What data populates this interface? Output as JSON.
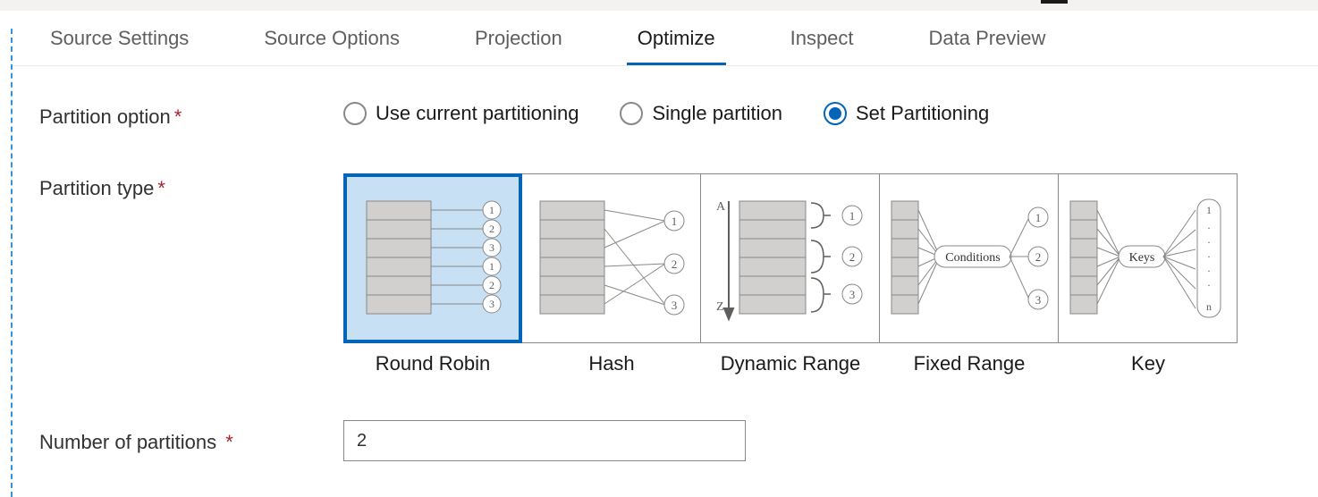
{
  "tabs": [
    {
      "label": "Source Settings",
      "active": false
    },
    {
      "label": "Source Options",
      "active": false
    },
    {
      "label": "Projection",
      "active": false
    },
    {
      "label": "Optimize",
      "active": true
    },
    {
      "label": "Inspect",
      "active": false
    },
    {
      "label": "Data Preview",
      "active": false
    }
  ],
  "form": {
    "partition_option": {
      "label": "Partition option",
      "options": [
        {
          "label": "Use current partitioning",
          "checked": false
        },
        {
          "label": "Single partition",
          "checked": false
        },
        {
          "label": "Set Partitioning",
          "checked": true
        }
      ]
    },
    "partition_type": {
      "label": "Partition type",
      "tiles": [
        {
          "label": "Round Robin",
          "selected": true
        },
        {
          "label": "Hash",
          "selected": false
        },
        {
          "label": "Dynamic Range",
          "selected": false
        },
        {
          "label": "Fixed Range",
          "selected": false
        },
        {
          "label": "Key",
          "selected": false
        }
      ]
    },
    "num_partitions": {
      "label": "Number of partitions",
      "value": "2"
    }
  },
  "icon_text": {
    "conditions": "Conditions",
    "keys": "Keys"
  }
}
